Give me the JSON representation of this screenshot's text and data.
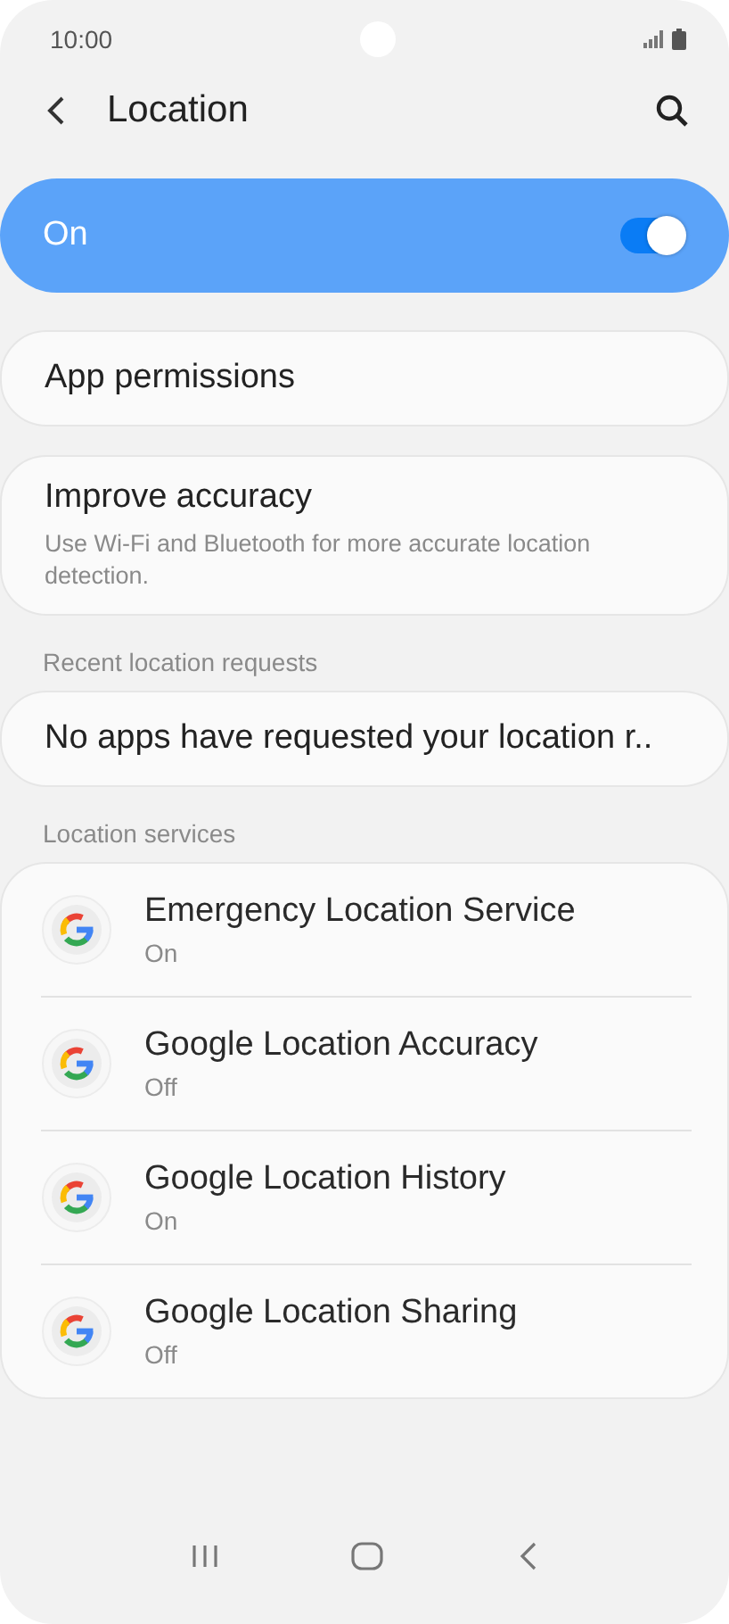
{
  "status_bar": {
    "time": "10:00"
  },
  "header": {
    "title": "Location"
  },
  "master_switch": {
    "label": "On",
    "on": true
  },
  "app_permissions": {
    "title": "App permissions"
  },
  "improve_accuracy": {
    "title": "Improve accuracy",
    "subtitle": "Use Wi-Fi and Bluetooth for more accurate location detection."
  },
  "recent_requests": {
    "heading": "Recent location requests",
    "message": "No apps have requested your location r.."
  },
  "location_services": {
    "heading": "Location services",
    "items": [
      {
        "title": "Emergency Location Service",
        "status": "On"
      },
      {
        "title": "Google Location Accuracy",
        "status": "Off"
      },
      {
        "title": "Google Location History",
        "status": "On"
      },
      {
        "title": "Google Location Sharing",
        "status": "Off"
      }
    ]
  }
}
